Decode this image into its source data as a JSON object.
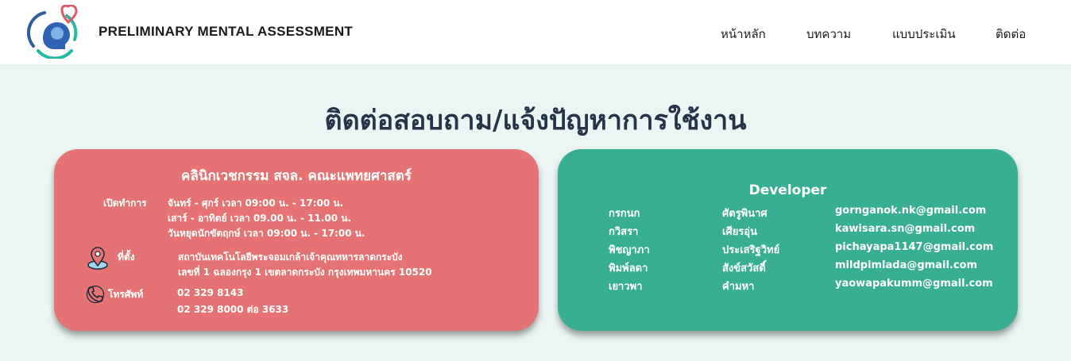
{
  "header": {
    "brand": "PRELIMINARY MENTAL ASSESSMENT",
    "nav": [
      {
        "label": "หน้าหลัก"
      },
      {
        "label": "บทความ"
      },
      {
        "label": "แบบประเมิน"
      },
      {
        "label": "ติดต่อ"
      }
    ]
  },
  "main": {
    "title": "ติดต่อสอบถาม/แจ้งปัญหาการใช้งาน"
  },
  "clinic": {
    "title": "คลินิกเวชกรรม สจล. คณะแพทยศาสตร์",
    "hours_label": "เปิดทำการ",
    "hours": [
      "จันทร์ - ศุกร์ เวลา 09:00 น. - 17:00 น.",
      "เสาร์ - อาทิตย์ เวลา 09.00 น. - 11.00 น.",
      "วันหยุดนักขัตฤกษ์ เวลา 09:00 น. - 17:00 น."
    ],
    "location_label": "ที่ตั้ง",
    "address": [
      "สถาบันเทคโนโลยีพระจอมเกล้าเจ้าคุณทหารลาดกระบัง",
      "เลขที่ 1 ฉลองกรุง 1 เขตลาดกระบัง กรุงเทพมหานคร 10520"
    ],
    "phone_label": "โทรศัพท์",
    "phones": [
      "02 329 8143",
      "02 329 8000 ต่อ 3633"
    ]
  },
  "developer": {
    "title": "Developer",
    "members": [
      {
        "first": "กรกนก",
        "last": "ศัตรูพินาศ",
        "email": "gornganok.nk@gmail.com"
      },
      {
        "first": "กวิสรา",
        "last": "เศียรอุ่น",
        "email": "kawisara.sn@gmail.com"
      },
      {
        "first": "พิชญาภา",
        "last": "ประเสริฐวิทย์",
        "email": "pichayapa1147@gmail.com"
      },
      {
        "first": "พิมพ์ลดา",
        "last": "สังข์สวัสดิ์",
        "email": "mildpimlada@gmail.com"
      },
      {
        "first": "เยาวพา",
        "last": "คำมหา",
        "email": "yaowapakumm@gmail.com"
      }
    ]
  },
  "colors": {
    "clinic_card": "#e57373",
    "developer_card": "#38ae92",
    "page_background": "#ebf5f3",
    "title_text": "#253448"
  },
  "icons": [
    "brain-heart-logo-icon",
    "location-pin-icon",
    "phone-icon"
  ]
}
